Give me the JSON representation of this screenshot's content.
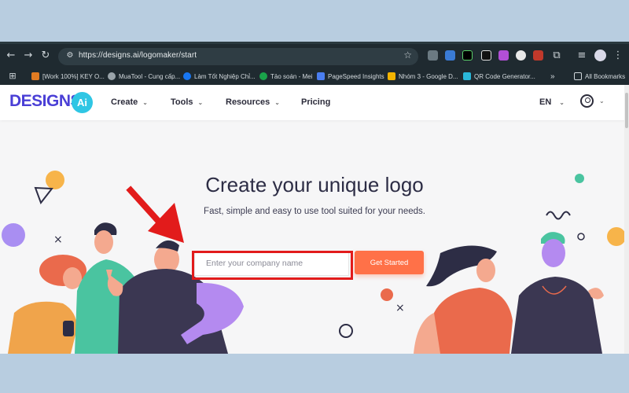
{
  "browser": {
    "url": "https://designs.ai/logomaker/start",
    "icons": [
      "back-icon",
      "forward-icon",
      "reload-icon",
      "site-settings-icon",
      "bookmark-star-icon",
      "extensions-icon",
      "reading-list-icon",
      "profile-avatar-icon",
      "menu-icon"
    ],
    "bookmarks": [
      {
        "label": "[Work 100%] KEY O...",
        "color": "#e07b22"
      },
      {
        "label": "MuaTool - Cung cấp...",
        "color": "#9aa4aa"
      },
      {
        "label": "Làm Tốt Nghiệp Chỉ...",
        "color": "#1877f2"
      },
      {
        "label": "Tảo soán - Mei",
        "color": "#1aa34a"
      },
      {
        "label": "PageSpeed Insights",
        "color": "#4a7ef0"
      },
      {
        "label": "Nhóm 3 - Google D...",
        "color": "#f4b400"
      },
      {
        "label": "QR Code Generator...",
        "color": "#2ab7d9"
      }
    ],
    "overflow": "»",
    "all_bookmarks": "All Bookmarks"
  },
  "site": {
    "logo_text": "DESIGNS.",
    "logo_badge": "Ai",
    "nav": {
      "create": "Create",
      "tools": "Tools",
      "resources": "Resources",
      "pricing": "Pricing"
    },
    "language": "EN",
    "brand_color": "#4a3fd6",
    "cta_color": "#ff7148"
  },
  "hero": {
    "title": "Create your unique logo",
    "subtitle": "Fast, simple and easy to use tool suited for your needs.",
    "input_placeholder": "Enter your company name",
    "cta_label": "Get Started"
  },
  "annotation": {
    "arrow_color": "#e21b1b",
    "highlight_color": "#e21b1b"
  }
}
